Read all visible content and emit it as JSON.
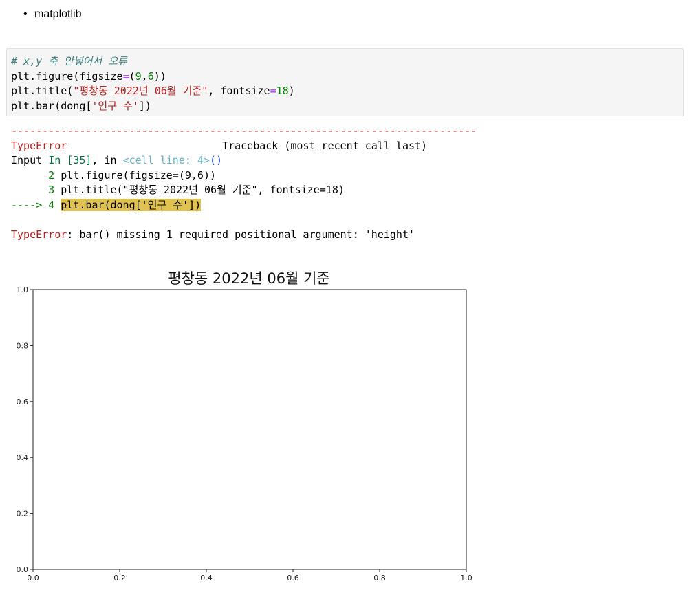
{
  "markdown": {
    "list_items": [
      "matplotlib"
    ]
  },
  "code_cell": {
    "comment": "# x,y 축 안넣어서 오류",
    "line2": {
      "fn": "plt.figure(figsize",
      "op": "=",
      "open": "(",
      "n1": "9",
      "comma": ",",
      "n2": "6",
      "close": "))"
    },
    "line3": {
      "fn": "plt.title(",
      "str": "\"평창동 2022년 06월 기준\"",
      "mid": ", fontsize",
      "op": "=",
      "num": "18",
      "close": ")"
    },
    "line4": {
      "fn": "plt.bar(dong[",
      "str": "'인구 수'",
      "close": "])"
    }
  },
  "traceback": {
    "separator": "---------------------------------------------------------------------------",
    "error_name": "TypeError",
    "header_right": "Traceback (most recent call last)",
    "input_prefix": "Input ",
    "in_label": "In [35]",
    "in_sep": ", in ",
    "cell_line": "<cell line: 4>",
    "parens": "()",
    "lines": [
      {
        "num": "      2 ",
        "code": "plt.figure(figsize=(9,6))"
      },
      {
        "num": "      3 ",
        "code": "plt.title(\"평창동 2022년 06월 기준\", fontsize=18)"
      }
    ],
    "arrow": "----> 4 ",
    "arrow_code": "plt.bar(dong['인구 수'])",
    "final_error_name": "TypeError",
    "final_message": ": bar() missing 1 required positional argument: 'height'"
  },
  "chart_data": {
    "type": "bar",
    "title": "평창동 2022년 06월 기준",
    "xlabel": "",
    "ylabel": "",
    "xlim": [
      0.0,
      1.0
    ],
    "ylim": [
      0.0,
      1.0
    ],
    "xticks": [
      "0.0",
      "0.2",
      "0.4",
      "0.6",
      "0.8",
      "1.0"
    ],
    "yticks": [
      "0.0",
      "0.2",
      "0.4",
      "0.6",
      "0.8",
      "1.0"
    ],
    "categories": [],
    "values": [],
    "grid": false
  }
}
